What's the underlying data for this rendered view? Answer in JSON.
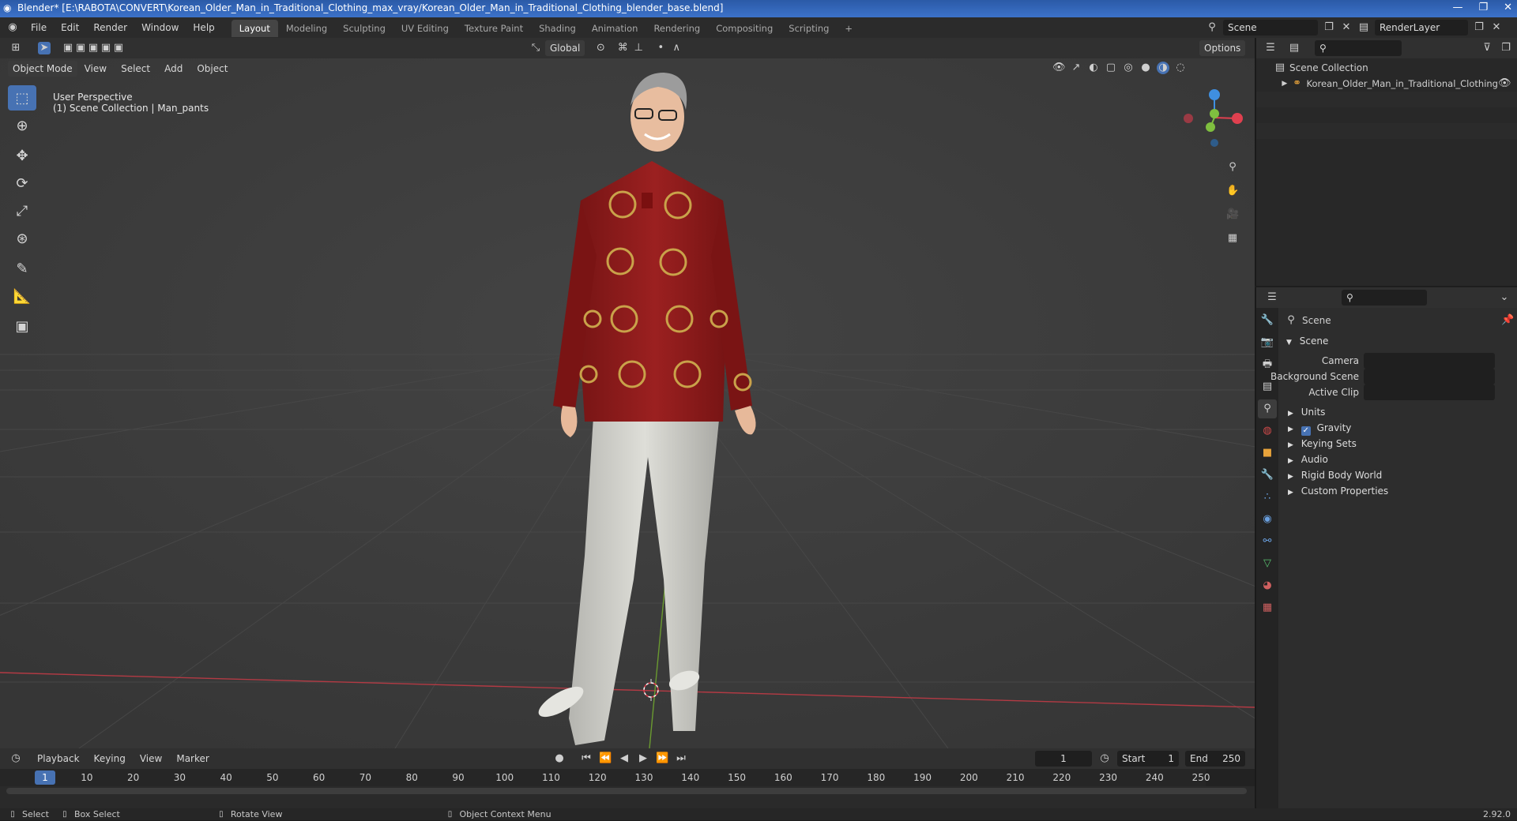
{
  "window": {
    "title": "Blender* [E:\\RABOTA\\CONVERT\\Korean_Older_Man_in_Traditional_Clothing_max_vray/Korean_Older_Man_in_Traditional_Clothing_blender_base.blend]"
  },
  "menu": [
    "File",
    "Edit",
    "Render",
    "Window",
    "Help"
  ],
  "workspaces": [
    "Layout",
    "Modeling",
    "Sculpting",
    "UV Editing",
    "Texture Paint",
    "Shading",
    "Animation",
    "Rendering",
    "Compositing",
    "Scripting",
    "+"
  ],
  "scene_field": "Scene",
  "renderlayer_field": "RenderLayer",
  "viewport": {
    "mode": "Object Mode",
    "menus": [
      "View",
      "Select",
      "Add",
      "Object"
    ],
    "orientation": "Global",
    "options": "Options",
    "perspective_label": "User Perspective",
    "collection_label": "(1) Scene Collection | Man_pants"
  },
  "outliner": {
    "root": "Scene Collection",
    "child": "Korean_Older_Man_in_Traditional_Clothing"
  },
  "properties": {
    "header": "Scene",
    "panel": "Scene",
    "fields": {
      "camera": "Camera",
      "background_scene": "Background Scene",
      "active_clip": "Active Clip"
    },
    "subpanels": [
      "Units",
      "Gravity",
      "Keying Sets",
      "Audio",
      "Rigid Body World",
      "Custom Properties"
    ],
    "gravity_checked": true
  },
  "timeline": {
    "menus": [
      "Playback",
      "Keying",
      "View",
      "Marker"
    ],
    "current_frame": "1",
    "start_label": "Start",
    "start_value": "1",
    "end_label": "End",
    "end_value": "250",
    "ruler": [
      "1",
      "10",
      "20",
      "30",
      "40",
      "50",
      "60",
      "70",
      "80",
      "90",
      "100",
      "110",
      "120",
      "130",
      "140",
      "150",
      "160",
      "170",
      "180",
      "190",
      "200",
      "210",
      "220",
      "230",
      "240",
      "250"
    ]
  },
  "status": {
    "select": "Select",
    "box_select": "Box Select",
    "rotate_view": "Rotate View",
    "context_menu": "Object Context Menu",
    "version": "2.92.0"
  },
  "colors": {
    "accent": "#4772b3",
    "shirt": "#8b1a1a",
    "pants": "#cfcfca",
    "x_axis": "#e0404f",
    "y_axis": "#7fbf3f",
    "z_axis": "#3f8fe0"
  }
}
